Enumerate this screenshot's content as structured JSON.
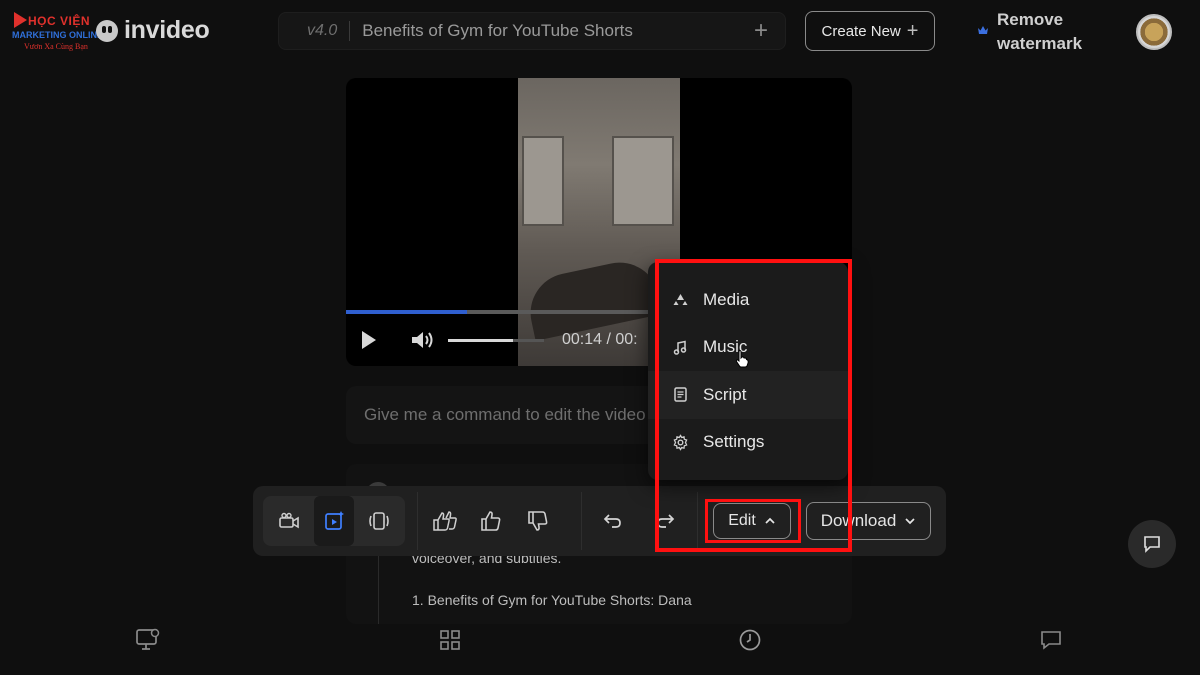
{
  "overlay": {
    "watermark_line1": "HỌC VIỆN",
    "watermark_line2": "MARKETING ONLINE",
    "watermark_line3": "Vươn Xa Cùng Bạn"
  },
  "header": {
    "brand": "invideo",
    "version": "v4.0",
    "project_title": "Benefits of Gym for YouTube Shorts",
    "title_add": "+",
    "create_new": "Create New",
    "create_new_plus": "+",
    "remove_watermark": "Remove watermark"
  },
  "player": {
    "time": "00:14 / 00:",
    "progress_fraction": 0.24,
    "volume_fraction": 0.68
  },
  "command": {
    "placeholder": "Give me a command to edit the video"
  },
  "chat": {
    "line1": "voiceover, and subtitles.",
    "line2": "1. Benefits of Gym for YouTube Shorts: Dana"
  },
  "toolbar": {
    "edit_label": "Edit",
    "download_label": "Download"
  },
  "edit_menu": {
    "items": [
      {
        "label": "Media",
        "icon": "media-icon"
      },
      {
        "label": "Music",
        "icon": "music-icon"
      },
      {
        "label": "Script",
        "icon": "script-icon"
      },
      {
        "label": "Settings",
        "icon": "settings-icon"
      }
    ]
  },
  "colors": {
    "background": "#0f0f0f",
    "accent": "#2f5fd0",
    "highlight": "#ff1010"
  }
}
